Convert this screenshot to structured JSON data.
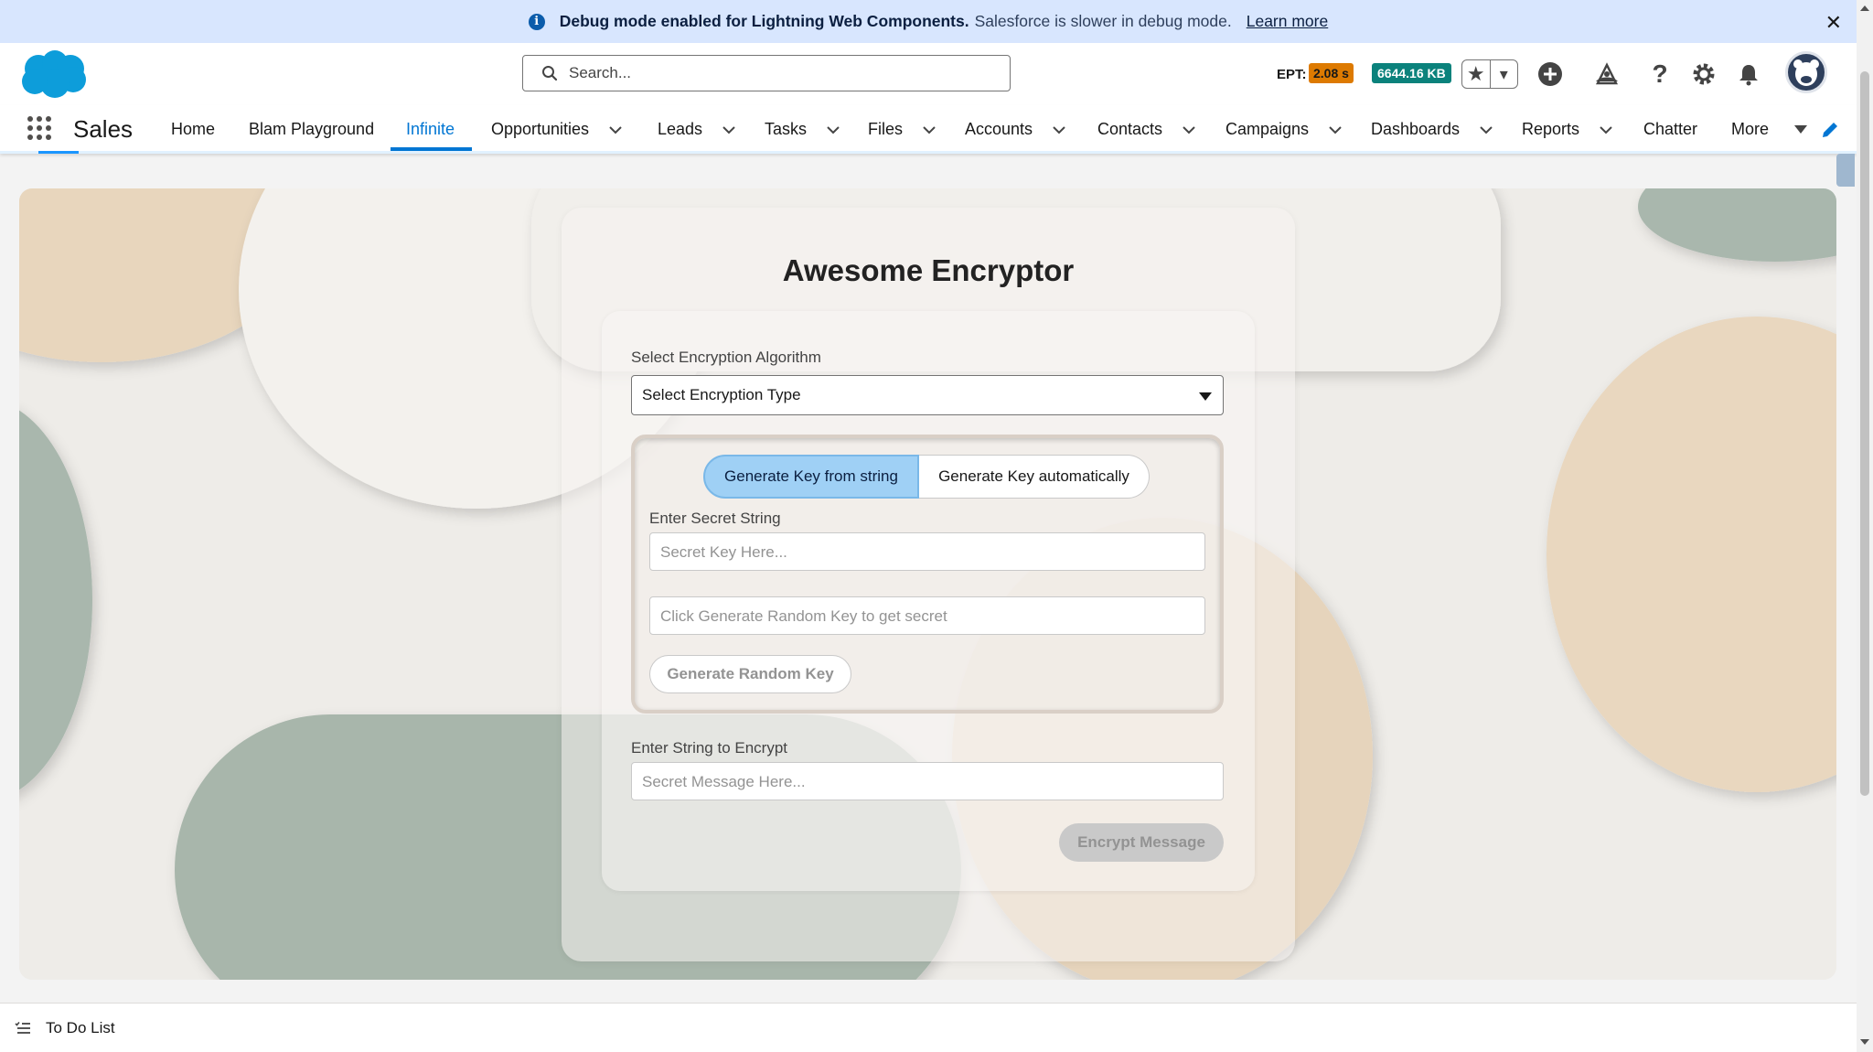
{
  "banner": {
    "bold_text": "Debug mode enabled for Lightning Web Components.",
    "text": "Salesforce is slower in debug mode.",
    "link": "Learn more"
  },
  "header": {
    "search_placeholder": "Search...",
    "ept_label": "EPT:",
    "ept_value": "2.08 s",
    "kb_value": "6644.16 KB"
  },
  "nav": {
    "app_name": "Sales",
    "items": [
      {
        "label": "Home",
        "has_menu": false
      },
      {
        "label": "Blam Playground",
        "has_menu": false
      },
      {
        "label": "Infinite",
        "has_menu": false,
        "active": true
      },
      {
        "label": "Opportunities",
        "has_menu": true
      },
      {
        "label": "Leads",
        "has_menu": true
      },
      {
        "label": "Tasks",
        "has_menu": true
      },
      {
        "label": "Files",
        "has_menu": true
      },
      {
        "label": "Accounts",
        "has_menu": true
      },
      {
        "label": "Contacts",
        "has_menu": true
      },
      {
        "label": "Campaigns",
        "has_menu": true
      },
      {
        "label": "Dashboards",
        "has_menu": true
      },
      {
        "label": "Reports",
        "has_menu": true
      },
      {
        "label": "Chatter",
        "has_menu": false
      },
      {
        "label": "More",
        "has_menu": true
      }
    ]
  },
  "encryptor": {
    "title": "Awesome Encryptor",
    "algorithm_label": "Select Encryption Algorithm",
    "algorithm_value": "Select Encryption Type",
    "toggle_from_string": "Generate Key from string",
    "toggle_auto": "Generate Key automatically",
    "secret_label": "Enter Secret String",
    "secret_placeholder": "Secret Key Here...",
    "random_placeholder": "Click Generate Random Key to get secret",
    "random_button": "Generate Random Key",
    "message_label": "Enter String to Encrypt",
    "message_placeholder": "Secret Message Here...",
    "encrypt_button": "Encrypt Message"
  },
  "footer": {
    "todo": "To Do List"
  },
  "colors": {
    "brand_blue": "#0176d3",
    "banner_bg": "#d8e6fe",
    "ept_badge": "#dd7a01",
    "kb_badge": "#0b827c",
    "toggle_active": "#9fd0f5"
  }
}
